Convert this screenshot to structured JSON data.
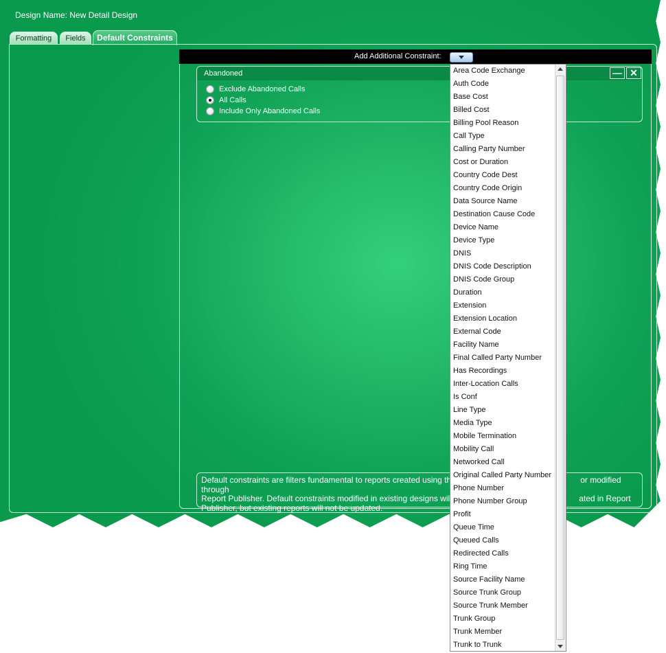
{
  "header": {
    "design_name": "Design Name: New Detail Design"
  },
  "tabs": [
    {
      "label": "Formatting"
    },
    {
      "label": "Fields"
    },
    {
      "label": "Default Constraints"
    }
  ],
  "constraint_bar": {
    "label": "Add Additional Constraint:"
  },
  "abandoned_panel": {
    "title": "Abandoned",
    "options": [
      {
        "label": "Exclude Abandoned Calls",
        "selected": false
      },
      {
        "label": "All Calls",
        "selected": true
      },
      {
        "label": "Include Only Abandoned Calls",
        "selected": false
      }
    ]
  },
  "info": {
    "line1": "Default constraints are filters fundamental to reports created using th",
    "line1b": "or modified through",
    "line2": "Report Publisher.  Default constraints modified in existing designs wil",
    "line2b": "ated in Report",
    "line3": "Publisher, but existing reports will not be updated."
  },
  "dropdown_list": [
    "Area Code Exchange",
    "Auth Code",
    "Base Cost",
    "Billed Cost",
    "Billing Pool Reason",
    "Call Type",
    "Calling Party Number",
    "Cost or Duration",
    "Country Code Dest",
    "Country Code Origin",
    "Data Source Name",
    "Destination Cause Code",
    "Device Name",
    "Device Type",
    "DNIS",
    "DNIS Code Description",
    "DNIS Code Group",
    "Duration",
    "Extension",
    "Extension Location",
    "External Code",
    "Facility Name",
    "Final Called Party Number",
    "Has Recordings",
    "Inter-Location Calls",
    "Is Conf",
    "Line Type",
    "Media Type",
    "Mobile Termination",
    "Mobility Call",
    "Networked Call",
    "Original Called Party Number",
    "Phone Number",
    "Phone Number Group",
    "Profit",
    "Queue Time",
    "Queued Calls",
    "Redirected Calls",
    "Ring Time",
    "Source Facility Name",
    "Source Trunk Group",
    "Source Trunk Member",
    "Trunk Group",
    "Trunk Member",
    "Trunk to Trunk"
  ]
}
